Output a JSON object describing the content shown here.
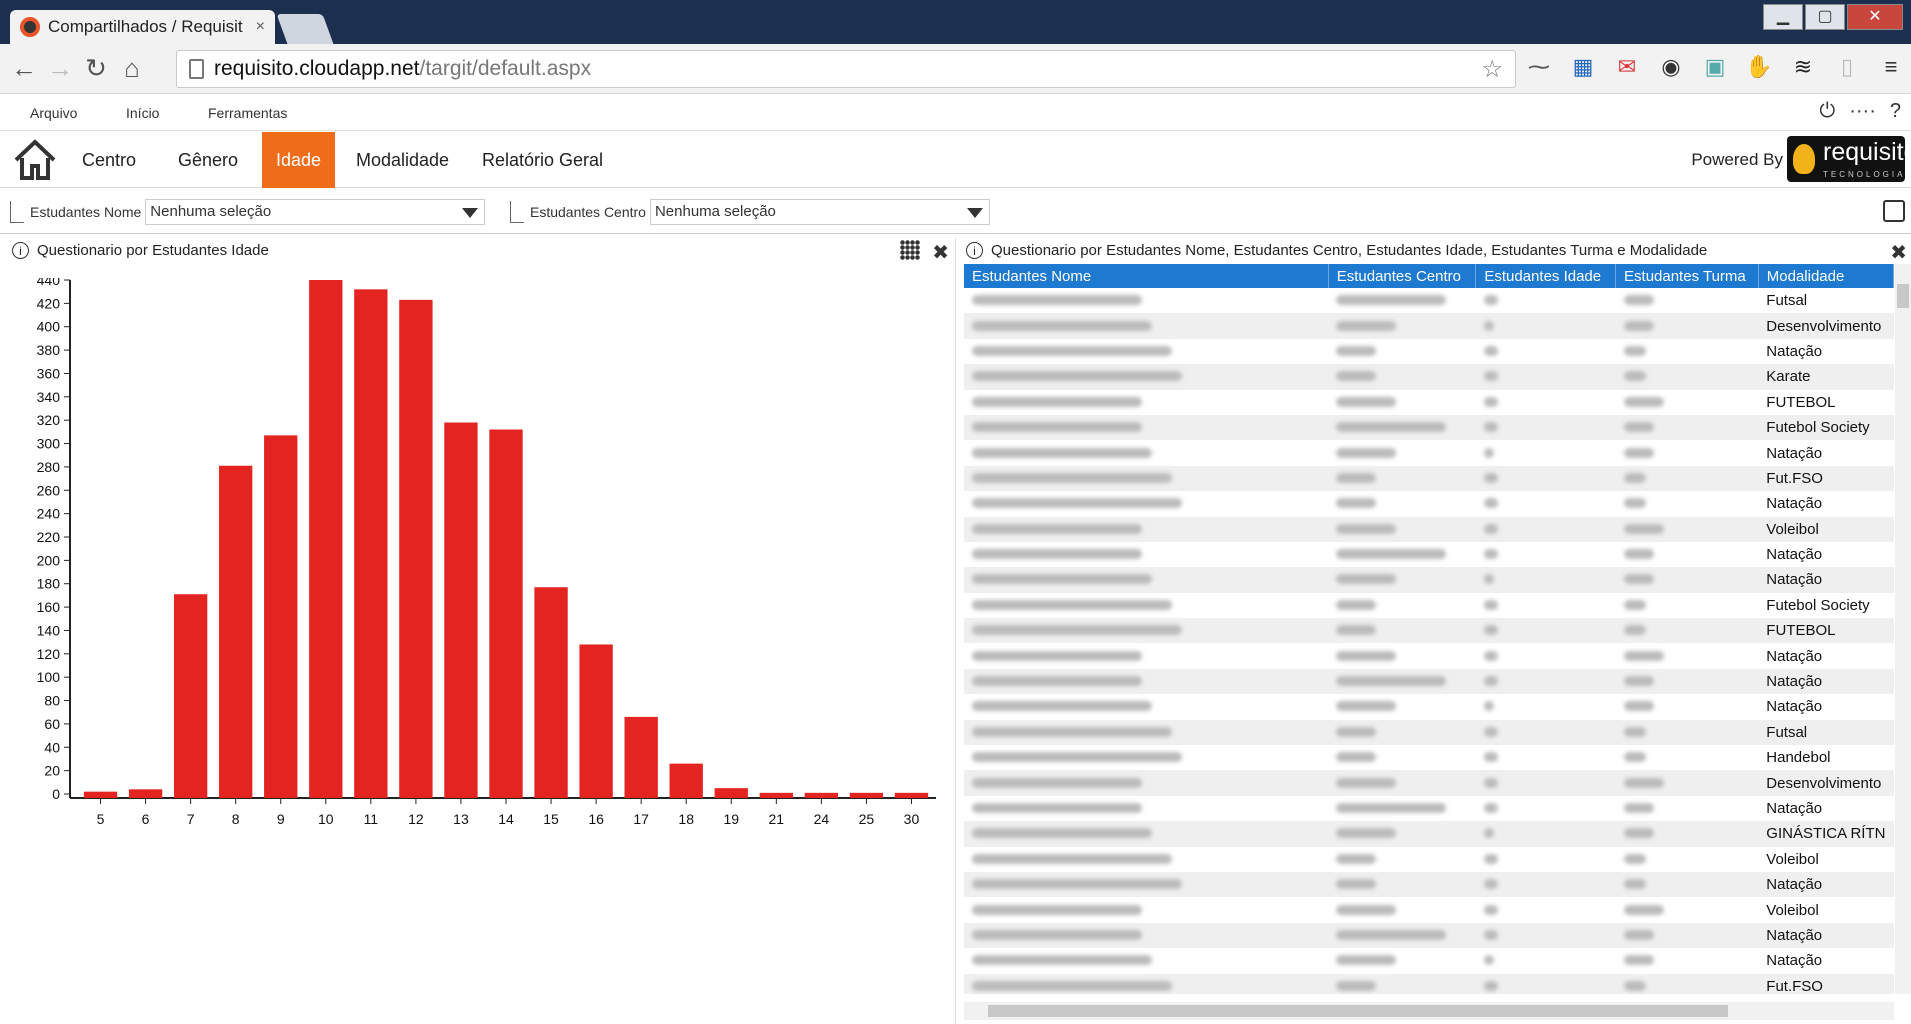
{
  "browser": {
    "tab_title": "Compartilhados / Requisit",
    "tab_close": "×",
    "url_domain": "requisito.cloudapp.net",
    "url_path": "/targit/default.aspx"
  },
  "menubar": {
    "file": "Arquivo",
    "start": "Início",
    "tools": "Ferramentas"
  },
  "nav": {
    "tabs": [
      "Centro",
      "Gênero",
      "Idade",
      "Modalidade",
      "Relatório Geral"
    ],
    "active": "Idade",
    "powered_by": "Powered By",
    "logo_text": "requisito",
    "logo_sub": "TECNOLOGIA"
  },
  "filters": [
    {
      "label": "Estudantes Nome",
      "value": "Nenhuma seleção"
    },
    {
      "label": "Estudantes Centro",
      "value": "Nenhuma seleção"
    }
  ],
  "left_panel": {
    "title": "Questionario por Estudantes Idade"
  },
  "chart_data": {
    "type": "bar",
    "title": "Questionario por Estudantes Idade",
    "categories": [
      "5",
      "6",
      "7",
      "8",
      "9",
      "10",
      "11",
      "12",
      "13",
      "14",
      "15",
      "16",
      "17",
      "18",
      "19",
      "21",
      "24",
      "25",
      "30"
    ],
    "values": [
      2,
      4,
      171,
      281,
      307,
      440,
      432,
      423,
      318,
      312,
      177,
      128,
      66,
      26,
      5,
      1,
      1,
      1,
      1
    ],
    "ylim": [
      0,
      440
    ],
    "yticks": [
      0,
      20,
      40,
      60,
      80,
      100,
      120,
      140,
      160,
      180,
      200,
      220,
      240,
      260,
      280,
      300,
      320,
      340,
      360,
      380,
      400,
      420,
      440
    ],
    "bar_color": "#e32421",
    "grid": false
  },
  "right_panel": {
    "title": "Questionario por Estudantes Nome, Estudantes Centro, Estudantes Idade, Estudantes Turma e Modalidade",
    "columns": [
      "Estudantes Nome",
      "Estudantes Centro",
      "Estudantes Idade",
      "Estudantes Turma",
      "Modalidade"
    ],
    "modalidades": [
      "Futsal",
      "Desenvolvimento",
      "Natação",
      "Karate",
      "FUTEBOL",
      "Futebol Society",
      "Natação",
      "Fut.FSO",
      "Natação",
      "Voleibol",
      "Natação",
      "Natação",
      "Futebol Society",
      "FUTEBOL",
      "Natação",
      "Natação",
      "Natação",
      "Futsal",
      "Handebol",
      "Desenvolvimento",
      "Natação",
      "GINÁSTICA RÍTN",
      "Voleibol",
      "Natação",
      "Voleibol",
      "Natação",
      "Natação",
      "Fut.FSO"
    ]
  },
  "colors": {
    "accent": "#ef6c1a",
    "header_blue": "#1e7ad0",
    "bar_red": "#e32421"
  }
}
